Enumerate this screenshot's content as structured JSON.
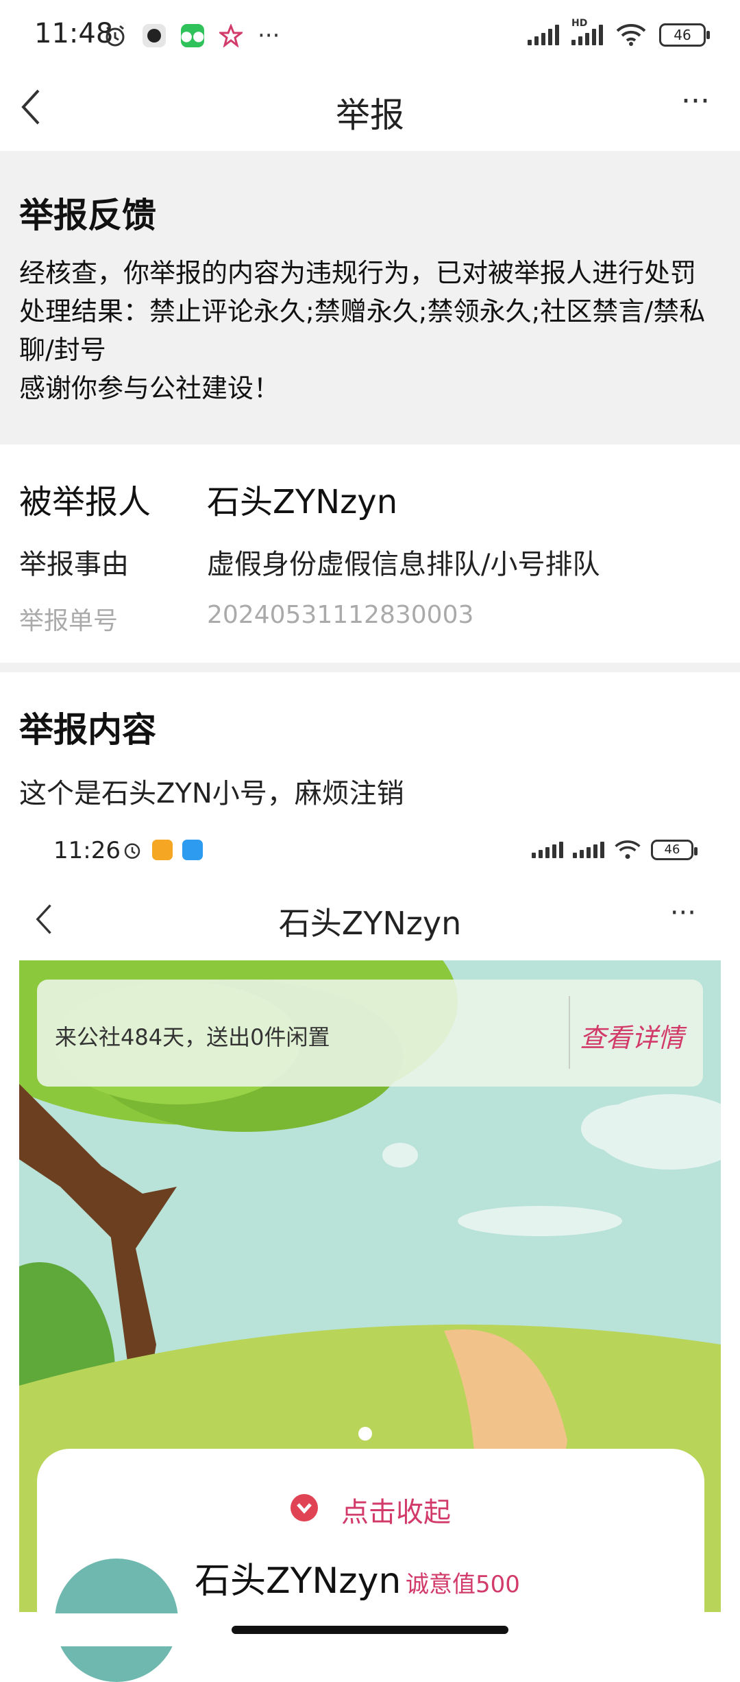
{
  "status_bar": {
    "time": "11:48",
    "battery": "46",
    "hd": "HD",
    "more": "···"
  },
  "nav": {
    "title": "举报",
    "more": "···"
  },
  "feedback": {
    "title": "举报反馈",
    "lines": [
      "经核查，你举报的内容为违规行为，已对被举报人进行处罚",
      "处理结果：禁止评论永久;禁赠永久;禁领永久;社区禁言/禁私",
      "聊/封号",
      "感谢你参与公社建设！"
    ]
  },
  "info": {
    "reported_label": "被举报人",
    "reported_value": "石头ZYNzyn",
    "reason_label": "举报事由",
    "reason_value": "虚假身份虚假信息排队/小号排队",
    "order_label": "举报单号",
    "order_value": "20240531112830003"
  },
  "content": {
    "title": "举报内容",
    "text": "这个是石头ZYN小号，麻烦注销"
  },
  "embedded": {
    "time": "11:26",
    "battery": "46",
    "nav_title": "石头ZYNzyn",
    "banner_text": "来公社484天，送出0件闲置",
    "banner_link": "查看详情",
    "collapse_label": "点击收起",
    "profile_name": "石头ZYNzyn",
    "sincerity": "诚意值500"
  },
  "colors": {
    "accent": "#d23a6a",
    "divider_gray": "#f1f1f1"
  }
}
